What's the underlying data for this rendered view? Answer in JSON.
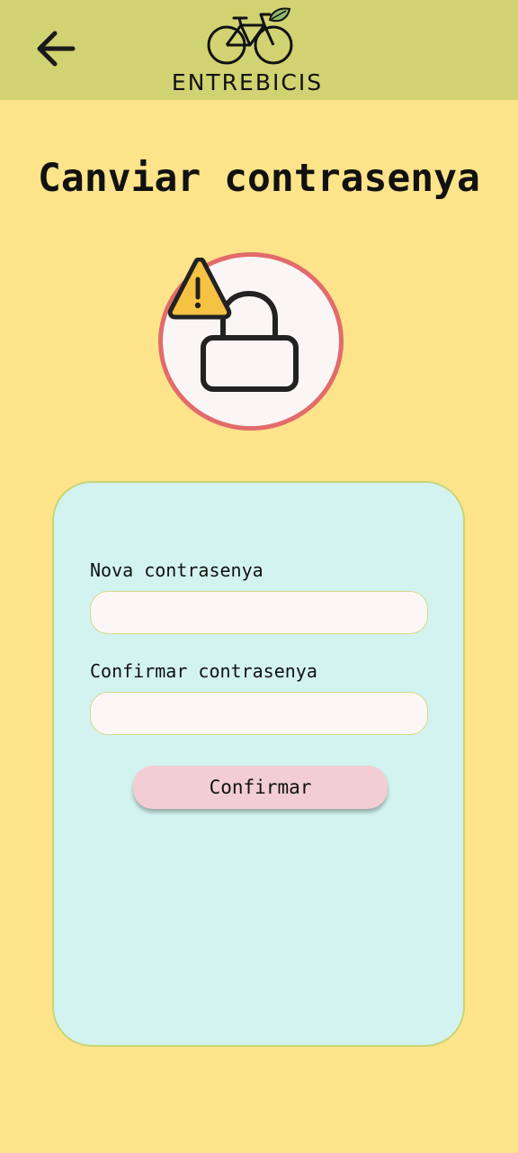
{
  "header": {
    "back_icon": "arrow-left-icon",
    "logo_icon": "bicycle-leaf-icon",
    "logo_text": "ENTREBICIS"
  },
  "page": {
    "title": "Canviar contrasenya",
    "hero_icons": [
      "warning-triangle-icon",
      "padlock-icon"
    ]
  },
  "form": {
    "new_password_label": "Nova contrasenya",
    "new_password_value": "",
    "confirm_password_label": "Confirmar contrasenya",
    "confirm_password_value": "",
    "submit_label": "Confirmar"
  },
  "colors": {
    "background": "#fde38a",
    "app_bar": "#d1d271",
    "card": "#d3f3f1",
    "card_border": "#c7d577",
    "hero_ring": "#e26b6b",
    "button": "#f2cdd4",
    "input_bg": "#fcf7f7"
  }
}
